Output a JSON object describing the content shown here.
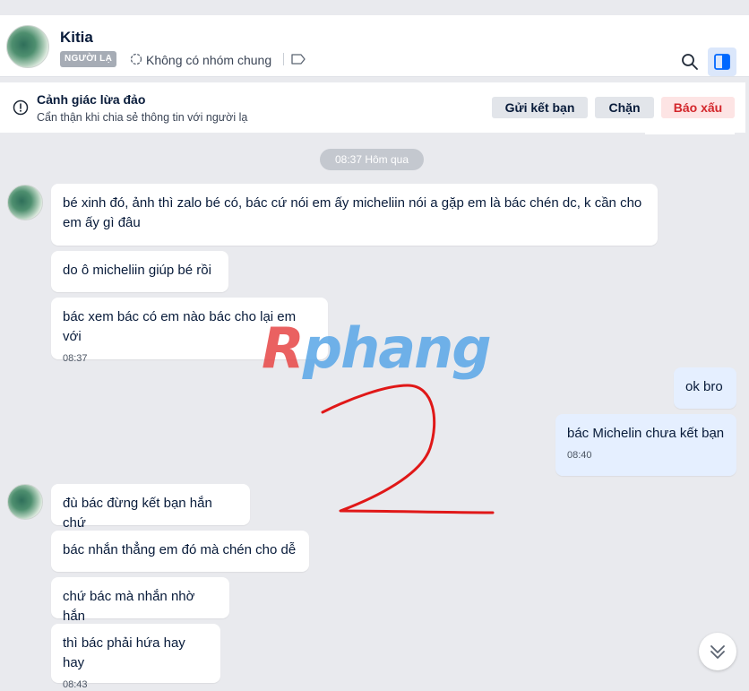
{
  "header": {
    "name": "Kitia",
    "badge": "NGƯỜI LẠ",
    "group_text": "Không có nhóm chung"
  },
  "warning": {
    "title": "Cảnh giác lừa đảo",
    "subtitle": "Cẩn thận khi chia sẻ thông tin với người lạ",
    "btn_friend": "Gửi kết bạn",
    "btn_block": "Chặn",
    "btn_report": "Báo xấu"
  },
  "chat": {
    "time_divider": "08:37 Hôm qua",
    "group1": [
      {
        "text": "bé xinh đó, ảnh thì zalo bé có, bác cứ nói em ấy micheliin nói a gặp em là bác chén dc, k cần cho em ấy gì đâu"
      },
      {
        "text": "do ô micheliin giúp bé rồi"
      },
      {
        "text": "bác xem bác có em nào bác cho lại em với",
        "time": "08:37"
      }
    ],
    "mine": [
      {
        "text": "ok bro"
      },
      {
        "text": "bác Michelin chưa kết bạn",
        "time": "08:40"
      }
    ],
    "group2": [
      {
        "text": "đù bác đừng kết bạn hắn chứ"
      },
      {
        "text": "bác nhắn thẳng em đó mà chén cho dễ"
      },
      {
        "text": "chứ bác mà nhắn nhờ hắn"
      },
      {
        "text": "thì bác phải hứa hay hay",
        "time": "08:43"
      }
    ]
  },
  "watermark": "Rphang",
  "icons": [
    "search-icon",
    "panel-toggle-icon",
    "group-icon",
    "tag-icon",
    "warning-icon",
    "chevron-double-down-icon"
  ]
}
